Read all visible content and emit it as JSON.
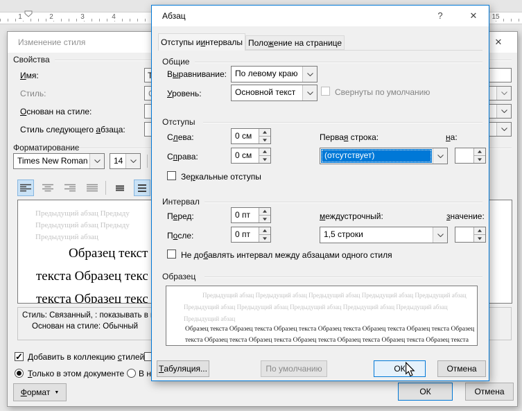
{
  "colors": {
    "accent": "#0078d7",
    "selection_blue": "#0078d7"
  },
  "ruler": {
    "marks": [
      "1",
      "2",
      "3",
      "4"
    ],
    "mark_right": "15"
  },
  "style_dialog": {
    "title": "Изменение стиля",
    "close_glyph": "✕",
    "properties": {
      "legend": "Свойства",
      "name_label": "[И]мя:",
      "name_value": "Т",
      "style_label": "Стиль:",
      "style_value": "С",
      "based_on_label": "[О]снован на стиле:",
      "next_style_label": "Стиль следующего [а]бзаца:"
    },
    "formatting": {
      "legend": "Форматирование",
      "font_name": "Times New Roman",
      "font_size": "14"
    },
    "preview": {
      "gray_lines": [
        "Предыдущий абзац Предыду",
        "Предыдущий абзац Предыду",
        "Предыдущий абзац"
      ],
      "sample_lines": [
        "Образец текст",
        "текста Образец текс",
        "текста Образец текс"
      ]
    },
    "description": {
      "line1": "Стиль: Связанный, : показывать в к",
      "line2": "Основан на стиле: Обычный"
    },
    "options": {
      "add_to_gallery": "Добавить в коллекцию [с]тилей",
      "only_this_document": "[Т]олько в этом документе",
      "new_documents_partial": "В н"
    },
    "buttons": {
      "format": "[Ф]ормат",
      "format_caret": "▼",
      "ok": "ОК",
      "cancel": "Отмена"
    }
  },
  "paragraph_dialog": {
    "title": "Абзац",
    "help_glyph": "?",
    "close_glyph": "✕",
    "tabs": [
      "Отступы и [и]нтервалы",
      "Поло[ж]ение на странице"
    ],
    "general": {
      "legend": "Общие",
      "alignment_label": "В[ы]равнивание:",
      "alignment_value": "По левому краю",
      "level_label": "[У]ровень:",
      "level_value": "Основной текст",
      "collapsed_checkbox": "Свернуты по умолчанию"
    },
    "indents": {
      "legend": "Отступы",
      "left_label": "С[л]ева:",
      "left_value": "0 см",
      "right_label": "С[п]рава:",
      "right_value": "0 см",
      "first_line_label": "Перва[я] строка:",
      "first_line_value": "(отсутствует)",
      "by_label": "[н]а:",
      "by_value": "",
      "mirror_checkbox": "Зе[р]кальные отступы"
    },
    "spacing": {
      "legend": "Интервал",
      "before_label": "П[е]ред:",
      "before_value": "0 пт",
      "after_label": "П[о]сле:",
      "after_value": "0 пт",
      "line_label": "[м]еждустрочный:",
      "line_value": "1,5 строки",
      "at_label": "[з]начение:",
      "at_value": "",
      "no_space_checkbox": "Не до[б]авлять интервал между абзацами одного стиля"
    },
    "preview": {
      "legend": "Образец",
      "gray_lines": [
        "Предыдущий абзац Предыдущий абзац Предыдущий абзац Предыдущий абзац Предыдущий абзац",
        "Предыдущий абзац Предыдущий абзац Предыдущий абзац Предыдущий абзац Предыдущий абзац",
        "Предыдущий абзац"
      ],
      "sample_lines": [
        "Образец текста Образец текста Образец текста Образец текста Образец текста Образец текста Образец",
        "текста Образец текста Образец текста Образец текста Образец текста Образец текста Образец текста"
      ]
    },
    "buttons": {
      "tabs": "[Т]абуляция...",
      "default": "По умолчанию",
      "ok": "ОК",
      "cancel": "Отмена"
    }
  }
}
